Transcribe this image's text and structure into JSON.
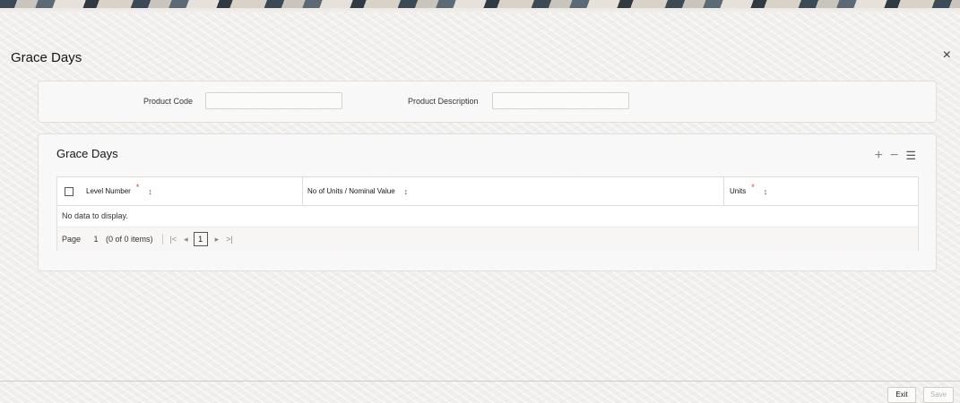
{
  "window": {
    "title": "Grace Days"
  },
  "header_fields": {
    "product_code_label": "Product Code",
    "product_code_value": "",
    "product_description_label": "Product Description",
    "product_description_value": ""
  },
  "section": {
    "title": "Grace Days",
    "toolbar": {
      "add": "+",
      "remove": "−",
      "list": "☰"
    }
  },
  "grid": {
    "columns": [
      {
        "label": "Level Number",
        "required": "*",
        "sort": "↕"
      },
      {
        "label": "No of Units / Nominal Value",
        "sort": "↕"
      },
      {
        "label": "Units",
        "required": "*",
        "sort": "↕"
      }
    ],
    "empty_text": "No data to display."
  },
  "pager": {
    "page_label": "Page",
    "page_value": "1",
    "count_text": "(0 of 0 items)",
    "first": "|<",
    "prev": "◂",
    "current": "1",
    "next": "▸",
    "last": ">|"
  },
  "footer": {
    "exit": "Exit",
    "save": "Save"
  },
  "close_icon": "×",
  "colors": {
    "required": "#c74634",
    "background": "#f1efed"
  }
}
